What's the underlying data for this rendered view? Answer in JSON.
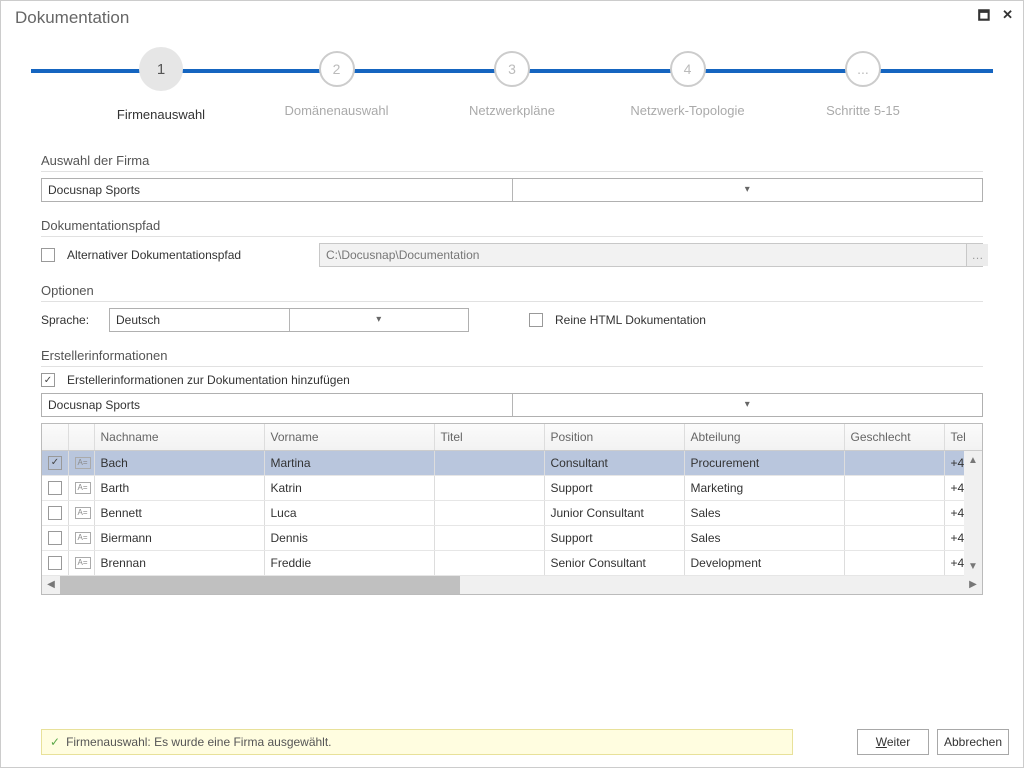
{
  "window": {
    "title": "Dokumentation"
  },
  "wizard": {
    "steps": [
      {
        "num": "1",
        "label": "Firmenauswahl"
      },
      {
        "num": "2",
        "label": "Domänenauswahl"
      },
      {
        "num": "3",
        "label": "Netzwerkpläne"
      },
      {
        "num": "4",
        "label": "Netzwerk-Topologie"
      },
      {
        "num": "...",
        "label": "Schritte 5-15"
      }
    ]
  },
  "sections": {
    "firm_select": "Auswahl der Firma",
    "doc_path": "Dokumentationspfad",
    "options": "Optionen",
    "creator": "Erstellerinformationen"
  },
  "firm": {
    "selected": "Docusnap Sports"
  },
  "doc_path": {
    "alt_label": "Alternativer Dokumentationspfad",
    "path": "C:\\Docusnap\\Documentation"
  },
  "options": {
    "lang_label": "Sprache:",
    "lang_value": "Deutsch",
    "html_only": "Reine HTML Dokumentation"
  },
  "creator": {
    "add_label": "Erstellerinformationen zur Dokumentation hinzufügen",
    "dropdown": "Docusnap Sports"
  },
  "columns": {
    "lastname": "Nachname",
    "firstname": "Vorname",
    "title": "Titel",
    "position": "Position",
    "department": "Abteilung",
    "gender": "Geschlecht",
    "phone": "Tel"
  },
  "rows": [
    {
      "checked": true,
      "lastname": "Bach",
      "firstname": "Martina",
      "title": "",
      "position": "Consultant",
      "department": "Procurement",
      "gender": "",
      "phone": "+4"
    },
    {
      "checked": false,
      "lastname": "Barth",
      "firstname": "Katrin",
      "title": "",
      "position": "Support",
      "department": "Marketing",
      "gender": "",
      "phone": "+4"
    },
    {
      "checked": false,
      "lastname": "Bennett",
      "firstname": "Luca",
      "title": "",
      "position": "Junior Consultant",
      "department": "Sales",
      "gender": "",
      "phone": "+4"
    },
    {
      "checked": false,
      "lastname": "Biermann",
      "firstname": "Dennis",
      "title": "",
      "position": "Support",
      "department": "Sales",
      "gender": "",
      "phone": "+4"
    },
    {
      "checked": false,
      "lastname": "Brennan",
      "firstname": "Freddie",
      "title": "",
      "position": "Senior Consultant",
      "department": "Development",
      "gender": "",
      "phone": "+4"
    }
  ],
  "status": {
    "text": "Firmenauswahl: Es wurde eine Firma ausgewählt."
  },
  "buttons": {
    "next_u": "W",
    "next_rest": "eiter",
    "cancel": "Abbrechen"
  }
}
